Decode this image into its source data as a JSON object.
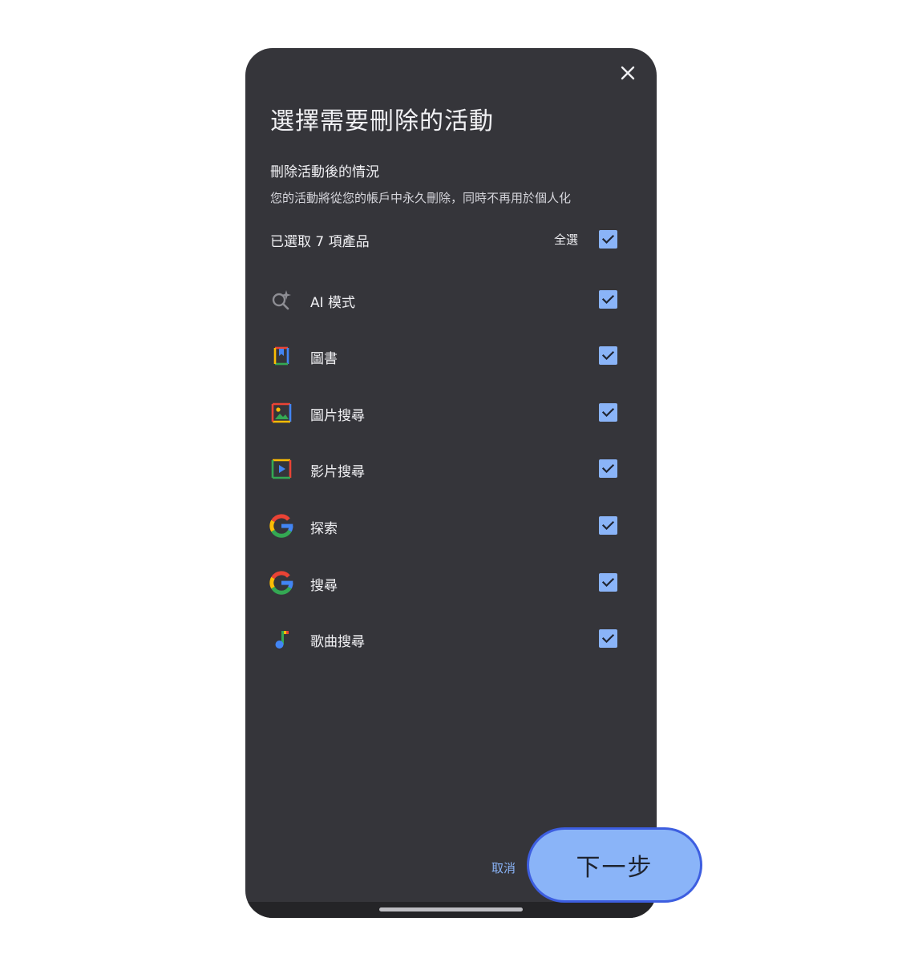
{
  "dialog": {
    "title": "選擇需要刪除的活動",
    "subtitle": "刪除活動後的情況",
    "description": "您的活動將從您的帳戶中永久刪除，同時不再用於個人化",
    "selected_count_text": "已選取 7 項產品",
    "select_all_label": "全選",
    "select_all_checked": true,
    "close_icon": "close-icon"
  },
  "products": [
    {
      "label": "AI 模式",
      "icon": "ai-search-sparkle-icon",
      "checked": true
    },
    {
      "label": "圖書",
      "icon": "books-icon",
      "checked": true
    },
    {
      "label": "圖片搜尋",
      "icon": "image-search-icon",
      "checked": true
    },
    {
      "label": "影片搜尋",
      "icon": "video-search-icon",
      "checked": true
    },
    {
      "label": "探索",
      "icon": "google-g-icon",
      "checked": true
    },
    {
      "label": "搜尋",
      "icon": "google-g-icon",
      "checked": true
    },
    {
      "label": "歌曲搜尋",
      "icon": "music-note-icon",
      "checked": true
    }
  ],
  "footer": {
    "cancel_label": "取消",
    "next_label": "下一步"
  },
  "colors": {
    "background": "#35353a",
    "accent": "#8ab4f8",
    "next_button_border": "#3d5ee0",
    "google_blue": "#4285f4",
    "google_red": "#ea4335",
    "google_yellow": "#fbbc04",
    "google_green": "#34a853"
  }
}
